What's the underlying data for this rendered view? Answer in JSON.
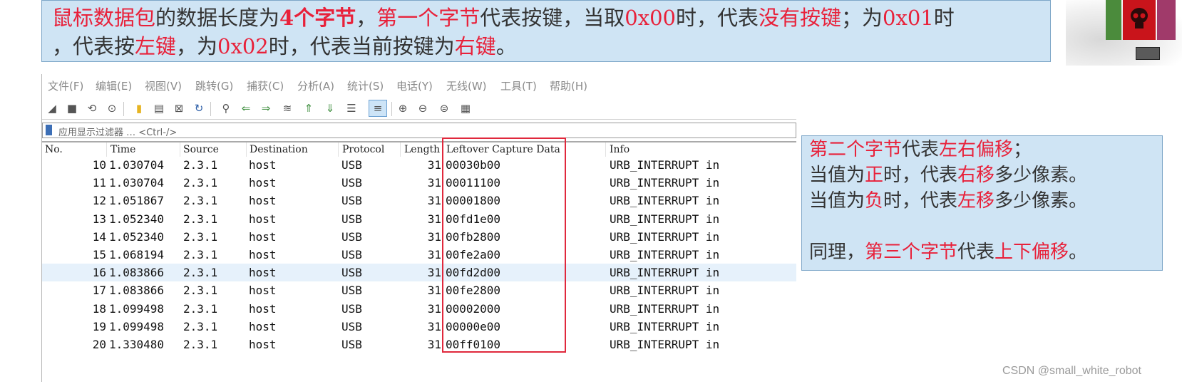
{
  "top_note": {
    "line1": [
      {
        "t": "鼠标数据包",
        "style": "red"
      },
      {
        "t": "的数据长度为",
        "style": ""
      },
      {
        "t": "4个字节",
        "style": "red-bold"
      },
      {
        "t": "，",
        "style": ""
      },
      {
        "t": "第一个字节",
        "style": "red"
      },
      {
        "t": "代表按键，当取",
        "style": ""
      },
      {
        "t": "0x00",
        "style": "red"
      },
      {
        "t": "时，代表",
        "style": ""
      },
      {
        "t": "没有按键",
        "style": "red"
      },
      {
        "t": "；为",
        "style": ""
      },
      {
        "t": "0x01",
        "style": "red"
      },
      {
        "t": "时",
        "style": ""
      }
    ],
    "line2": [
      {
        "t": "，代表按",
        "style": ""
      },
      {
        "t": "左键",
        "style": "red"
      },
      {
        "t": "，为",
        "style": ""
      },
      {
        "t": "0x02",
        "style": "red"
      },
      {
        "t": "时，代表当前按键为",
        "style": ""
      },
      {
        "t": "右键",
        "style": "red"
      },
      {
        "t": "。",
        "style": ""
      }
    ]
  },
  "menu": [
    "文件(F)",
    "编辑(E)",
    "视图(V)",
    "跳转(G)",
    "捕获(C)",
    "分析(A)",
    "统计(S)",
    "电话(Y)",
    "无线(W)",
    "工具(T)",
    "帮助(H)"
  ],
  "filter": {
    "placeholder": "应用显示过滤器 … <Ctrl-/>"
  },
  "columns": {
    "no": "No.",
    "time": "Time",
    "source": "Source",
    "destination": "Destination",
    "protocol": "Protocol",
    "length": "Length",
    "leftover": "Leftover Capture Data",
    "info": "Info"
  },
  "packets": [
    {
      "no": "10",
      "time": "1.030704",
      "src": "2.3.1",
      "dst": "host",
      "proto": "USB",
      "len": "31",
      "data": "00030b00",
      "info": "URB_INTERRUPT in"
    },
    {
      "no": "11",
      "time": "1.030704",
      "src": "2.3.1",
      "dst": "host",
      "proto": "USB",
      "len": "31",
      "data": "00011100",
      "info": "URB_INTERRUPT in"
    },
    {
      "no": "12",
      "time": "1.051867",
      "src": "2.3.1",
      "dst": "host",
      "proto": "USB",
      "len": "31",
      "data": "00001800",
      "info": "URB_INTERRUPT in"
    },
    {
      "no": "13",
      "time": "1.052340",
      "src": "2.3.1",
      "dst": "host",
      "proto": "USB",
      "len": "31",
      "data": "00fd1e00",
      "info": "URB_INTERRUPT in"
    },
    {
      "no": "14",
      "time": "1.052340",
      "src": "2.3.1",
      "dst": "host",
      "proto": "USB",
      "len": "31",
      "data": "00fb2800",
      "info": "URB_INTERRUPT in"
    },
    {
      "no": "15",
      "time": "1.068194",
      "src": "2.3.1",
      "dst": "host",
      "proto": "USB",
      "len": "31",
      "data": "00fe2a00",
      "info": "URB_INTERRUPT in"
    },
    {
      "no": "16",
      "time": "1.083866",
      "src": "2.3.1",
      "dst": "host",
      "proto": "USB",
      "len": "31",
      "data": "00fd2d00",
      "info": "URB_INTERRUPT in",
      "selected": true
    },
    {
      "no": "17",
      "time": "1.083866",
      "src": "2.3.1",
      "dst": "host",
      "proto": "USB",
      "len": "31",
      "data": "00fe2800",
      "info": "URB_INTERRUPT in"
    },
    {
      "no": "18",
      "time": "1.099498",
      "src": "2.3.1",
      "dst": "host",
      "proto": "USB",
      "len": "31",
      "data": "00002000",
      "info": "URB_INTERRUPT in"
    },
    {
      "no": "19",
      "time": "1.099498",
      "src": "2.3.1",
      "dst": "host",
      "proto": "USB",
      "len": "31",
      "data": "00000e00",
      "info": "URB_INTERRUPT in"
    },
    {
      "no": "20",
      "time": "1.330480",
      "src": "2.3.1",
      "dst": "host",
      "proto": "USB",
      "len": "31",
      "data": "00ff0100",
      "info": "URB_INTERRUPT in"
    }
  ],
  "side_note": {
    "lines": [
      [
        {
          "t": "第二个字节",
          "style": "red"
        },
        {
          "t": "代表",
          "style": ""
        },
        {
          "t": "左右偏移",
          "style": "red"
        },
        {
          "t": "；",
          "style": ""
        }
      ],
      [
        {
          "t": "当值为",
          "style": ""
        },
        {
          "t": "正",
          "style": "red"
        },
        {
          "t": "时，代表",
          "style": ""
        },
        {
          "t": "右移",
          "style": "red"
        },
        {
          "t": "多少像素。",
          "style": ""
        }
      ],
      [
        {
          "t": "当值为",
          "style": ""
        },
        {
          "t": "负",
          "style": "red"
        },
        {
          "t": "时，代表",
          "style": ""
        },
        {
          "t": "左移",
          "style": "red"
        },
        {
          "t": "多少像素。",
          "style": ""
        }
      ],
      [
        {
          "t": "",
          "style": ""
        }
      ],
      [
        {
          "t": "同理，",
          "style": ""
        },
        {
          "t": "第三个字节",
          "style": "red"
        },
        {
          "t": "代表",
          "style": ""
        },
        {
          "t": "上下偏移",
          "style": "red"
        },
        {
          "t": "。",
          "style": ""
        }
      ]
    ]
  },
  "watermark": "CSDN @small_white_robot",
  "colors": {
    "accent_red": "#e8213a",
    "note_bg": "#cfe4f4",
    "selected_row": "#e6f1fb"
  },
  "toolbar_icons": [
    "shark-fin-start-icon",
    "stop-square-icon",
    "restart-fin-icon",
    "options-gear-icon",
    "open-folder-icon",
    "save-file-icon",
    "close-file-icon",
    "reload-icon",
    "find-icon",
    "go-back-icon",
    "go-forward-icon",
    "go-to-packet-icon",
    "first-packet-icon",
    "last-packet-icon",
    "auto-scroll-icon",
    "colorize-icon",
    "zoom-in-icon",
    "zoom-out-icon",
    "normal-size-icon",
    "resize-columns-icon"
  ]
}
